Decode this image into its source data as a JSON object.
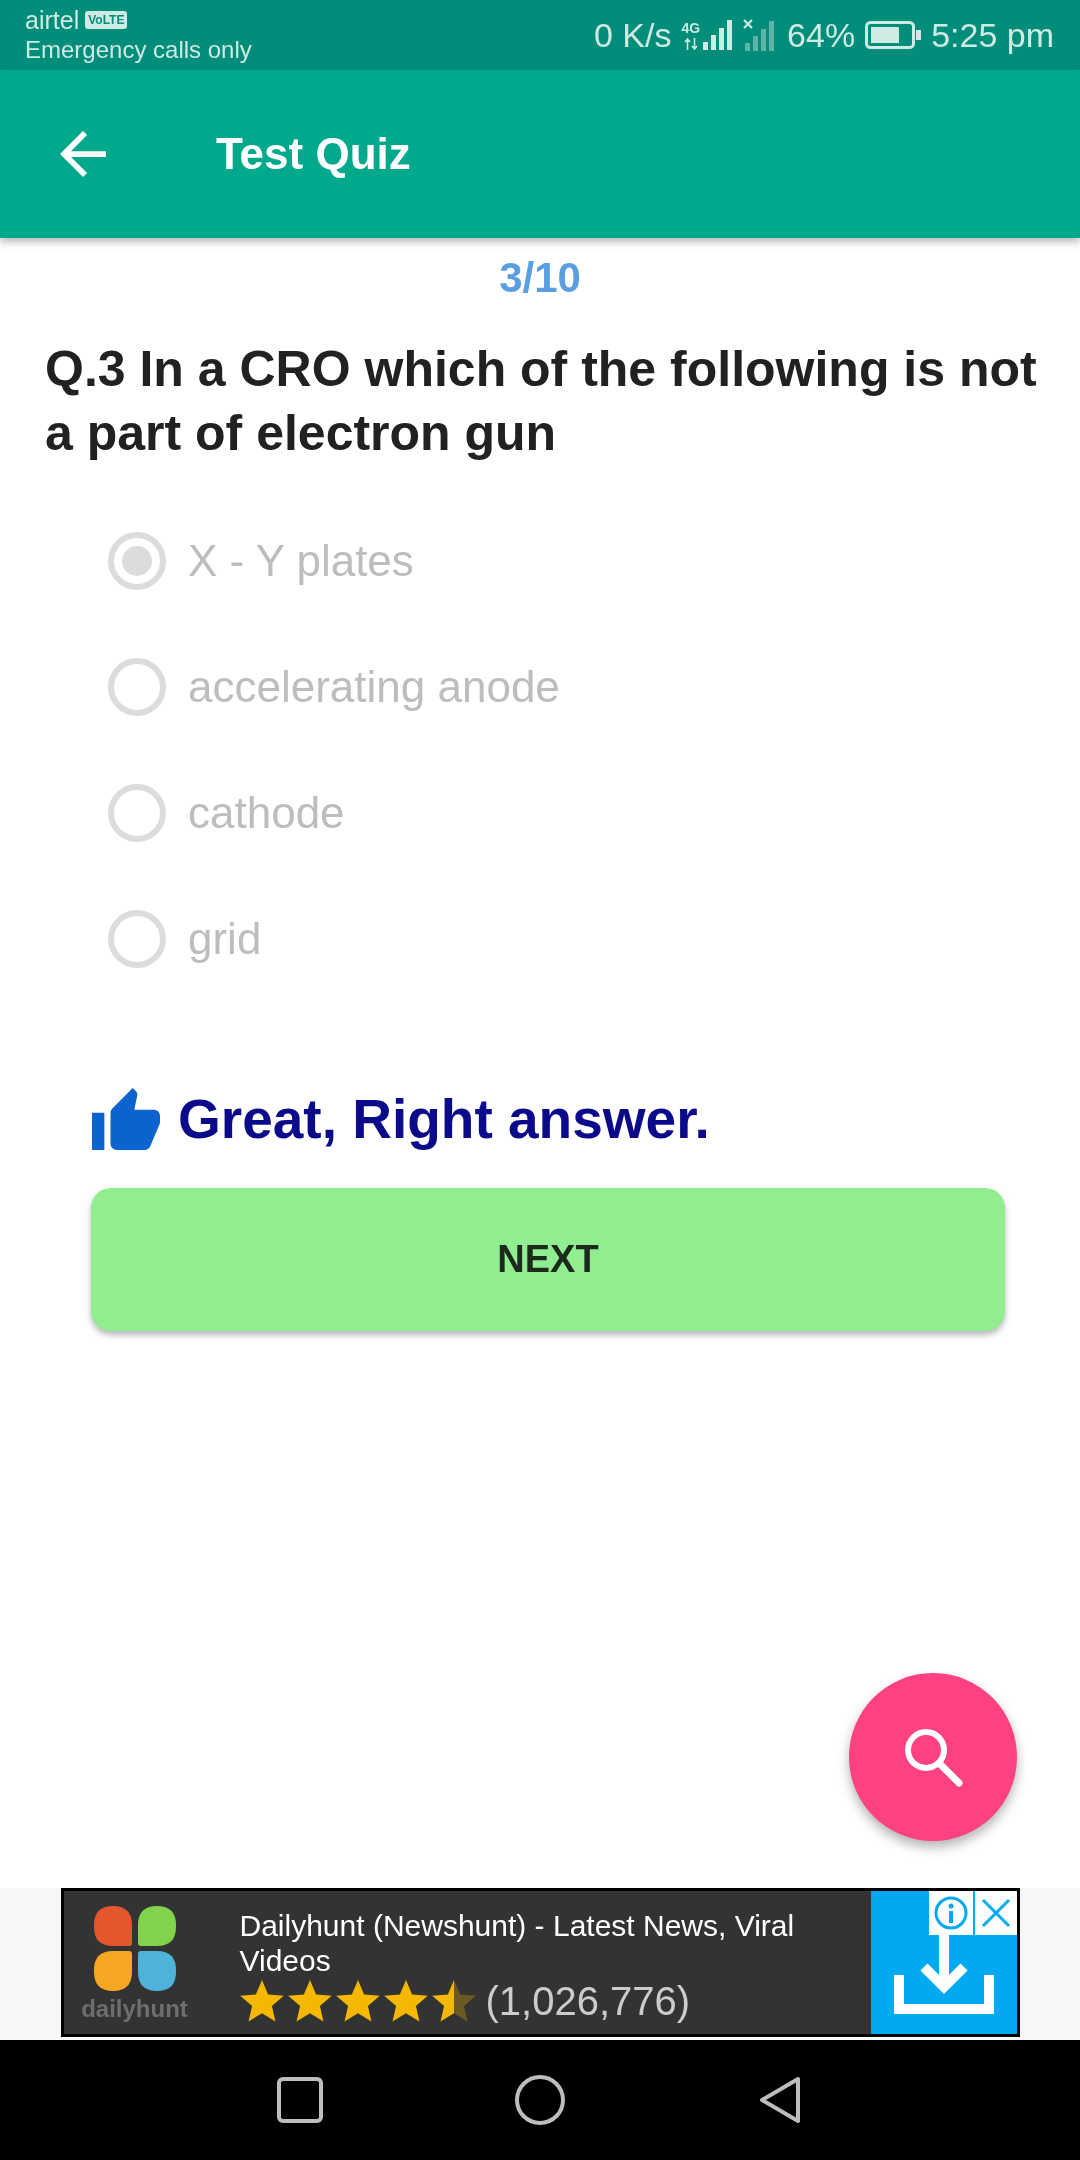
{
  "status_bar": {
    "carrier": "airtel",
    "carrier_badge": "VoLTE",
    "network_status": "Emergency calls only",
    "data_speed": "0 K/s",
    "network_type": "4G",
    "battery": "64%",
    "time": "5:25 pm"
  },
  "app_bar": {
    "title": "Test Quiz"
  },
  "quiz": {
    "progress": "3/10",
    "question": "Q.3 In a CRO which of the following is not a part of electron gun",
    "options": [
      {
        "label": "X - Y plates",
        "selected": true,
        "disabled": true
      },
      {
        "label": "accelerating anode",
        "selected": false,
        "disabled": true
      },
      {
        "label": "cathode",
        "selected": false,
        "disabled": true
      },
      {
        "label": "grid",
        "selected": false,
        "disabled": true
      }
    ],
    "feedback": {
      "kind": "correct",
      "text": "Great, Right answer."
    },
    "next_button": "NEXT"
  },
  "ad": {
    "brand": "dailyhunt",
    "title": "Dailyhunt (Newshunt) - Latest News, Viral Videos",
    "stars": 4.5,
    "rating_count": "(1,026,776)"
  }
}
